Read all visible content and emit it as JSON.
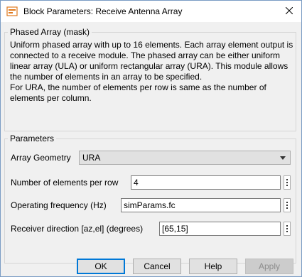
{
  "window": {
    "title": "Block Parameters: Receive Antenna Array"
  },
  "mask": {
    "group_label": "Phased Array (mask)",
    "description": "Uniform phased array with up to 16 elements. Each array element output is connected to a receive module. The phased array can be either uniform linear array (ULA) or uniform rectangular array (URA). This module allows the number of elements in an array to be specified.\nFor URA, the number of elements per row is same as the number of elements per column."
  },
  "parameters": {
    "group_label": "Parameters",
    "array_geometry": {
      "label": "Array Geometry",
      "value": "URA"
    },
    "elements_per_row": {
      "label": "Number of elements per row",
      "value": "4"
    },
    "operating_frequency": {
      "label": "Operating frequency (Hz)",
      "value": "simParams.fc"
    },
    "receiver_direction": {
      "label": "Receiver direction [az,el] (degrees)",
      "value": "[65,15]"
    }
  },
  "buttons": {
    "ok": "OK",
    "cancel": "Cancel",
    "help": "Help",
    "apply": "Apply"
  },
  "icons": {
    "app": "simulink-block-icon",
    "close": "close-icon",
    "dropdown": "chevron-down-icon",
    "more": "vertical-ellipsis-icon"
  },
  "colors": {
    "dialog_bg": "#f0f0f0",
    "default_button_border": "#0078d7",
    "window_border": "#7a9cc4"
  }
}
